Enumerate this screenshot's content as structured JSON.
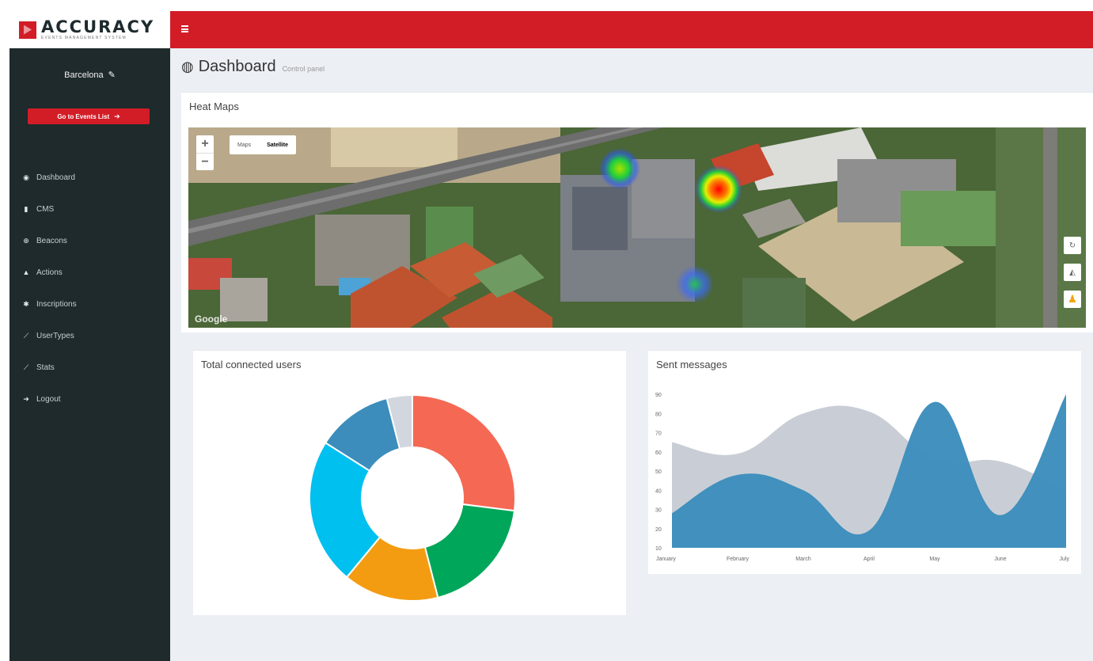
{
  "brand": {
    "name": "ACCURACY",
    "tagline": "EVENTS MANAGEMENT SYSTEM",
    "color": "#d21d27"
  },
  "sidebar": {
    "city": "Barcelona",
    "events_button": "Go to Events List",
    "items": [
      {
        "label": "Dashboard",
        "icon": "dashboard-icon"
      },
      {
        "label": "CMS",
        "icon": "file-icon"
      },
      {
        "label": "Beacons",
        "icon": "beacon-icon"
      },
      {
        "label": "Actions",
        "icon": "bell-icon"
      },
      {
        "label": "Inscriptions",
        "icon": "users-icon"
      },
      {
        "label": "UserTypes",
        "icon": "line-chart-icon"
      },
      {
        "label": "Stats",
        "icon": "line-chart-icon"
      },
      {
        "label": "Logout",
        "icon": "logout-icon"
      }
    ]
  },
  "header": {
    "title": "Dashboard",
    "subtitle": "Control panel"
  },
  "heatmap": {
    "title": "Heat Maps",
    "map_types": [
      "Maps",
      "Satellite"
    ],
    "active_map_type": "Satellite",
    "attribution": "Google"
  },
  "users_chart": {
    "title": "Total connected users"
  },
  "messages_chart": {
    "title": "Sent messages"
  },
  "chart_data": [
    {
      "type": "pie",
      "title": "Total connected users",
      "donut": true,
      "slices": [
        {
          "value": 27,
          "color": "#f56954"
        },
        {
          "value": 19,
          "color": "#00a65a"
        },
        {
          "value": 15,
          "color": "#f39c12"
        },
        {
          "value": 23,
          "color": "#00c0ef"
        },
        {
          "value": 12,
          "color": "#3c8dbc"
        },
        {
          "value": 4,
          "color": "#d2d6de"
        }
      ]
    },
    {
      "type": "area",
      "title": "Sent messages",
      "categories": [
        "January",
        "February",
        "March",
        "April",
        "May",
        "June",
        "July"
      ],
      "ylim": [
        10,
        90
      ],
      "yticks": [
        10,
        20,
        30,
        40,
        50,
        60,
        70,
        80,
        90
      ],
      "grid": false,
      "series": [
        {
          "values": [
            65,
            59,
            80,
            81,
            56,
            55,
            40
          ],
          "color": "#c9ced6"
        },
        {
          "values": [
            28,
            48,
            40,
            19,
            86,
            27,
            90
          ],
          "color": "#3c8dbc"
        }
      ]
    }
  ]
}
